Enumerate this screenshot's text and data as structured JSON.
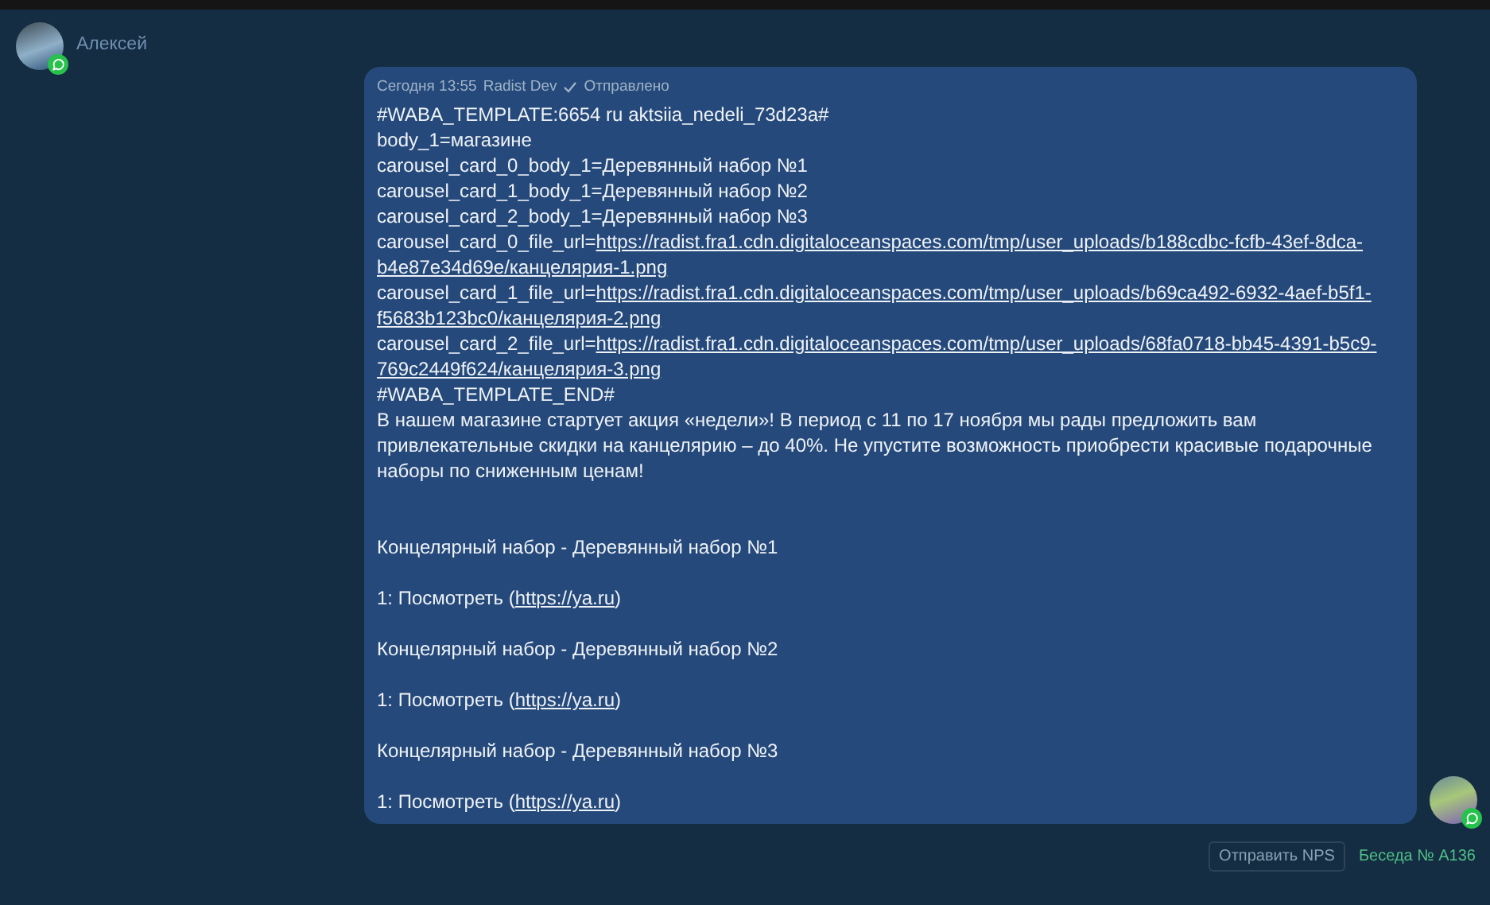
{
  "contact": {
    "name": "Алексей"
  },
  "message": {
    "time": "Сегодня 13:55",
    "author": "Radist Dev",
    "status": "Отправлено",
    "delivered": true,
    "lines": [
      {
        "kind": "line",
        "text": "#WABA_TEMPLATE:6654 ru aktsiia_nedeli_73d23a#"
      },
      {
        "kind": "line",
        "text": "body_1=магазине"
      },
      {
        "kind": "line",
        "text": "carousel_card_0_body_1=Деревянный набор №1"
      },
      {
        "kind": "line",
        "text": "carousel_card_1_body_1=Деревянный набор №2"
      },
      {
        "kind": "line",
        "text": "carousel_card_2_body_1=Деревянный набор №3"
      },
      {
        "kind": "link",
        "text": "carousel_card_0_file_url=",
        "link": "https://radist.fra1.cdn.digitaloceanspaces.com/tmp/user_uploads/b188cdbc-fcfb-43ef-8dca-"
      },
      {
        "kind": "link",
        "link": "b4e87e34d69e/канцелярия-1.png"
      },
      {
        "kind": "link",
        "text": "carousel_card_1_file_url=",
        "link": "https://radist.fra1.cdn.digitaloceanspaces.com/tmp/user_uploads/b69ca492-6932-4aef-b5f1-"
      },
      {
        "kind": "link",
        "link": "f5683b123bc0/канцелярия-2.png"
      },
      {
        "kind": "link",
        "text": "carousel_card_2_file_url=",
        "link": "https://radist.fra1.cdn.digitaloceanspaces.com/tmp/user_uploads/68fa0718-bb45-4391-b5c9-"
      },
      {
        "kind": "link",
        "link": "769c2449f624/канцелярия-3.png"
      },
      {
        "kind": "line",
        "text": "#WABA_TEMPLATE_END#"
      },
      {
        "kind": "line",
        "text": "В нашем магазине стартует акция «недели»! В период с 11 по 17 ноября мы рады предложить вам привлекательные скидки на канцелярию – до 40%. Не упустите возможность приобрести красивые подарочные наборы по сниженным ценам!"
      },
      {
        "kind": "section",
        "text": "Концелярный набор - Деревянный набор №1"
      },
      {
        "kind": "spaced",
        "text": "1: Посмотреть (",
        "link": "https://ya.ru",
        "after": ")"
      },
      {
        "kind": "spaced",
        "text": "Концелярный набор - Деревянный набор №2"
      },
      {
        "kind": "spaced",
        "text": "1: Посмотреть (",
        "link": "https://ya.ru",
        "after": ")"
      },
      {
        "kind": "spaced",
        "text": "Концелярный набор - Деревянный набор №3"
      },
      {
        "kind": "spaced",
        "text": "1: Посмотреть (",
        "link": "https://ya.ru",
        "after": ")"
      }
    ]
  },
  "footer": {
    "button": "Отправить NPS",
    "conversation": "Беседа № A136"
  }
}
